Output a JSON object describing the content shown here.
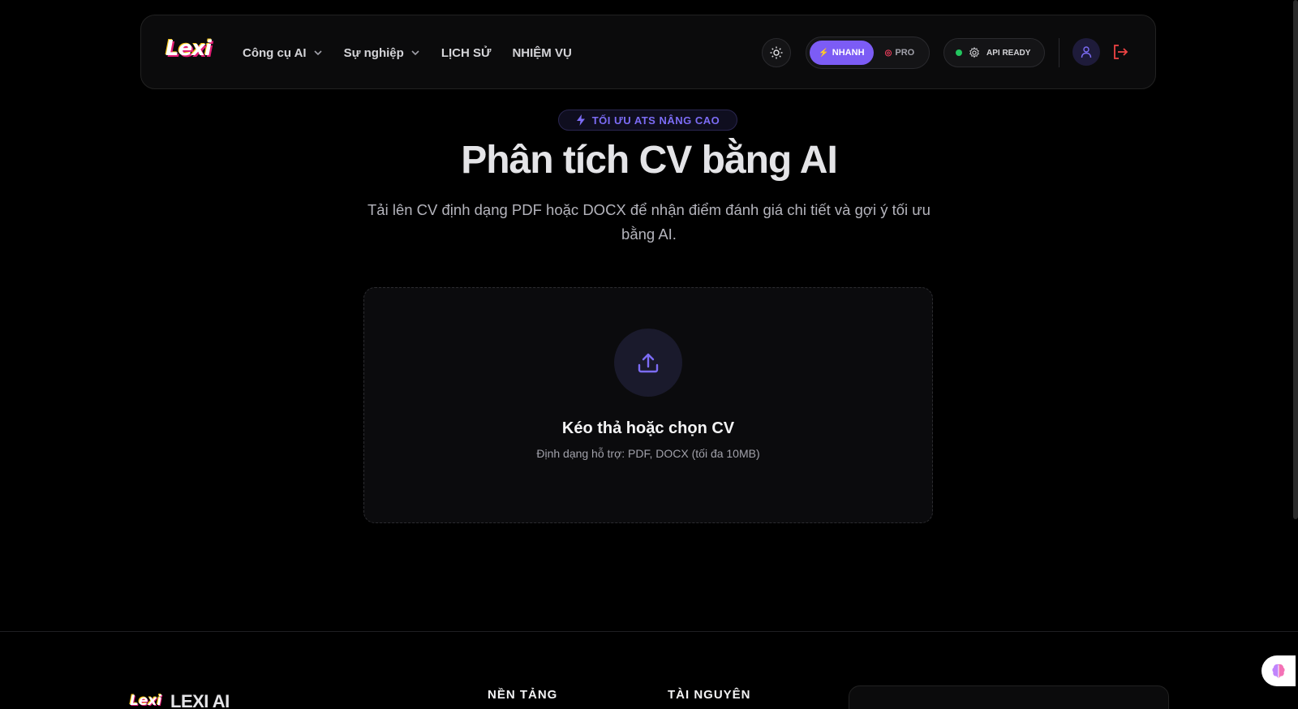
{
  "brand": {
    "logo_text": "Lexi",
    "footer_brand": "LEXI AI"
  },
  "nav": {
    "items": [
      {
        "label": "Công cụ AI",
        "has_dropdown": true
      },
      {
        "label": "Sự nghiệp",
        "has_dropdown": true
      },
      {
        "label": "LỊCH SỬ",
        "has_dropdown": false
      },
      {
        "label": "NHIỆM VỤ",
        "has_dropdown": false
      }
    ],
    "theme_icon": "sun-icon",
    "mode_fast_label": "NHANH",
    "mode_pro_label": "PRO",
    "mode_selected": "NHANH",
    "api_status_label": "API READY",
    "api_status_color": "#22c55e",
    "user_icon": "user-icon",
    "logout_icon": "logout-icon"
  },
  "hero": {
    "badge": "TỐI ƯU ATS NÂNG CAO",
    "title": "Phân tích CV bằng AI",
    "subtitle": "Tải lên CV định dạng PDF hoặc DOCX để nhận điểm đánh giá chi tiết và gợi ý tối ưu bằng AI."
  },
  "upload": {
    "icon": "upload-icon",
    "title": "Kéo thả hoặc chọn CV",
    "hint": "Định dạng hỗ trợ: PDF, DOCX (tối đa 10MB)"
  },
  "footer": {
    "col_platform": "NỀN TẢNG",
    "col_resources": "TÀI NGUYÊN"
  },
  "colors": {
    "accent": "#7c5cf5",
    "background": "#000000",
    "danger": "#ef4444"
  }
}
